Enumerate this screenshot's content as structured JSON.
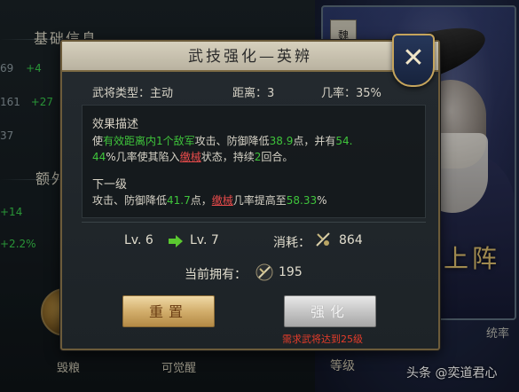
{
  "background": {
    "left_panel": {
      "heading_1": "基础信息",
      "rows": [
        {
          "value": "69",
          "delta": "+4"
        },
        {
          "value": "161",
          "delta": "+27"
        },
        {
          "value": "37",
          "delta": ""
        }
      ],
      "heading_2": "额外",
      "extra_rows": [
        {
          "delta": "+14"
        },
        {
          "delta": "+2.2%"
        }
      ],
      "bottom_buttons": [
        {
          "label": "毁粮"
        },
        {
          "label": "可觉醒"
        }
      ]
    },
    "hero": {
      "faction_tag": "魏",
      "battle_tag": "上阵",
      "side_stat": "统率",
      "level_label": "等级"
    },
    "watermark": "头条 @奕道君心"
  },
  "modal": {
    "title": "武技强化—英辨",
    "close_symbol": "✕",
    "info": {
      "type_label": "武将类型：主动",
      "range_label": "距离：3",
      "rate_label": "几率：35%"
    },
    "effect": {
      "title": "效果描述",
      "line1": {
        "p1": "使",
        "g1": "有效距离内1个敌军",
        "p2": "攻击、防御降低",
        "g2": "38.9",
        "p3": "点，并有",
        "g3": "54."
      },
      "line2": {
        "g1": "44",
        "p1": "%几率使其陷入",
        "r1": "缴械",
        "p2": "状态，持续",
        "g2": "2",
        "p3": "回合。"
      }
    },
    "next_level": {
      "title": "下一级",
      "p1": "攻击、防御降低",
      "g1": "41.7",
      "p2": "点，",
      "r1": "缴械",
      "p3": "几率提高至",
      "g2": "58.33",
      "p4": "%"
    },
    "level": {
      "from": "Lv. 6",
      "to": "Lv. 7"
    },
    "cost": {
      "label": "消耗：",
      "value": "864"
    },
    "owned": {
      "label": "当前拥有：",
      "value": "195"
    },
    "buttons": {
      "reset": "重置",
      "upgrade": "强化",
      "requirement": "需求武将达到25级"
    },
    "colors": {
      "accent_green": "#3fc43b",
      "accent_red": "#e84b4b",
      "reset_gold": "#d2ae6c",
      "upgrade_disabled": "#c6c6c6"
    }
  }
}
